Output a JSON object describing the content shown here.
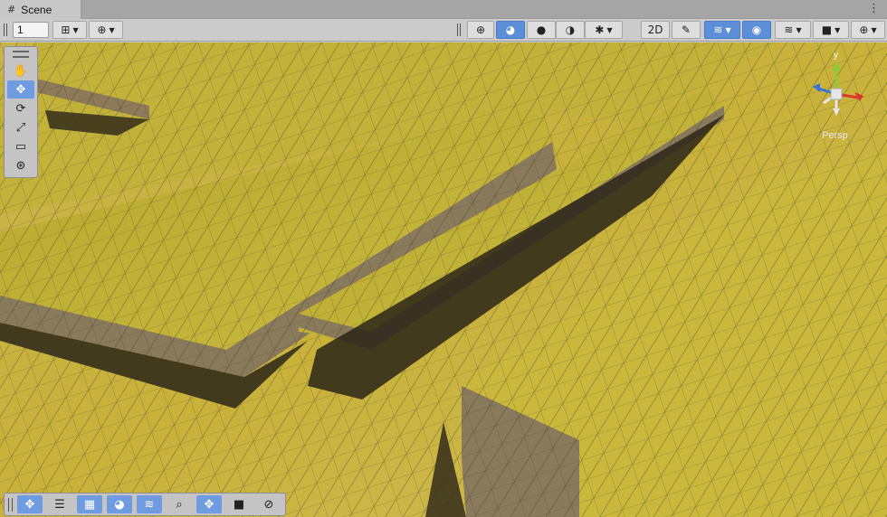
{
  "window": {
    "tab_title": "Scene",
    "tab_icon": "grid-hash-icon",
    "menu_icon": "kebab-menu-icon"
  },
  "toolbar": {
    "grid_size_value": "1",
    "left_buttons": [
      {
        "name": "grid-snapping-button",
        "glyph": "⊞",
        "dropdown": true
      },
      {
        "name": "increment-snap-button",
        "glyph": "⊕",
        "dropdown": true
      }
    ],
    "right_buttons": [
      {
        "name": "draw-mode-wireframe-button",
        "glyph": "⊕",
        "active": false,
        "dropdown": false
      },
      {
        "name": "draw-mode-shaded-wireframe-button",
        "glyph": "◕",
        "active": true,
        "dropdown": false
      },
      {
        "name": "draw-mode-shaded-button",
        "glyph": "●",
        "active": false,
        "dropdown": false
      },
      {
        "name": "draw-mode-lit-button",
        "glyph": "◑",
        "active": false,
        "dropdown": false
      },
      {
        "name": "debug-draw-button",
        "glyph": "✱",
        "active": false,
        "dropdown": true
      },
      {
        "name": "2d-toggle-button",
        "glyph": "2D",
        "active": false,
        "dropdown": false
      },
      {
        "name": "lighting-toggle-button",
        "glyph": "✎",
        "active": false,
        "dropdown": false
      },
      {
        "name": "effects-toggle-button",
        "glyph": "≋",
        "active": true,
        "dropdown": true
      },
      {
        "name": "scene-visibility-button",
        "glyph": "◉",
        "active": true,
        "dropdown": false
      },
      {
        "name": "layers-button",
        "glyph": "≋",
        "active": false,
        "dropdown": true
      },
      {
        "name": "camera-settings-button",
        "glyph": "■",
        "active": false,
        "dropdown": true
      },
      {
        "name": "gizmos-button",
        "glyph": "⊕",
        "active": false,
        "dropdown": true
      }
    ]
  },
  "tools": [
    {
      "name": "hand-tool-icon",
      "glyph": "✋",
      "active": false
    },
    {
      "name": "move-tool-icon",
      "glyph": "✥",
      "active": true
    },
    {
      "name": "rotate-tool-icon",
      "glyph": "⟳",
      "active": false
    },
    {
      "name": "scale-tool-icon",
      "glyph": "⤢",
      "active": false
    },
    {
      "name": "rect-tool-icon",
      "glyph": "▭",
      "active": false
    },
    {
      "name": "transform-tool-icon",
      "glyph": "⊛",
      "active": false
    }
  ],
  "gizmo": {
    "axis_label_y": "y",
    "projection_label": "Persp",
    "colors": {
      "x": "#d9382b",
      "y": "#8bcc3a",
      "z": "#3a74d9",
      "center": "#e6e6e6"
    }
  },
  "overlay_bar": [
    {
      "name": "terrain-move-icon",
      "glyph": "✥",
      "active": true
    },
    {
      "name": "terrain-settings-icon",
      "glyph": "☰",
      "active": false
    },
    {
      "name": "paint-texture-icon",
      "glyph": "▦",
      "active": true
    },
    {
      "name": "sculpt-icon",
      "glyph": "◕",
      "active": true
    },
    {
      "name": "terrain-layers-icon",
      "glyph": "≋",
      "active": true
    },
    {
      "name": "search-icon",
      "glyph": "⌕",
      "active": false
    },
    {
      "name": "move-pivot-icon",
      "glyph": "✥",
      "active": true
    },
    {
      "name": "camera-preview-icon",
      "glyph": "■",
      "active": false
    },
    {
      "name": "navigation-icon",
      "glyph": "⊘",
      "active": false
    }
  ],
  "viewport": {
    "name": "scene-viewport",
    "terrain_color": "#c4b63c",
    "shadow_color": "#2a2418",
    "cliff_color": "#8a7a5c"
  }
}
